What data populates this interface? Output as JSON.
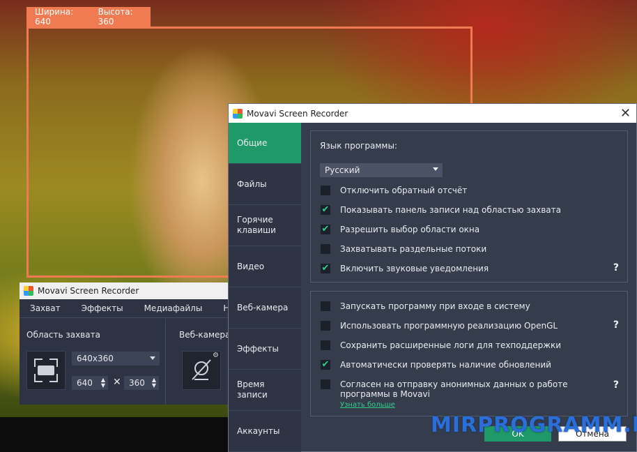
{
  "capture_overlay": {
    "width_label": "Ширина: 640",
    "height_label": "Высота: 360"
  },
  "small_window": {
    "title": "Movavi Screen Recorder",
    "menu": [
      "Захват",
      "Эффекты",
      "Медиафайлы",
      "Настр"
    ],
    "capture_area_label": "Область захвата",
    "resolution_value": "640x360",
    "width_value": "640",
    "height_value": "360",
    "times_sign": "✕",
    "webcam_label": "Веб-камера"
  },
  "dialog": {
    "title": "Movavi Screen Recorder",
    "close_glyph": "✕",
    "nav": [
      {
        "label": "Общие"
      },
      {
        "label": "Файлы"
      },
      {
        "label": "Горячие клавиши"
      },
      {
        "label": "Видео"
      },
      {
        "label": "Веб-камера"
      },
      {
        "label": "Эффекты"
      },
      {
        "label": "Время записи"
      },
      {
        "label": "Аккаунты"
      }
    ],
    "language_label": "Язык программы:",
    "language_value": "Русский",
    "group1": [
      {
        "label": "Отключить обратный отсчёт",
        "checked": false
      },
      {
        "label": "Показывать панель записи над областью захвата",
        "checked": true
      },
      {
        "label": "Разрешить выбор области окна",
        "checked": true
      },
      {
        "label": "Захватывать раздельные потоки",
        "checked": false
      },
      {
        "label": "Включить звуковые уведомления",
        "checked": true
      }
    ],
    "group2": [
      {
        "label": "Запускать программу при входе в систему",
        "checked": false
      },
      {
        "label": "Использовать программную реализацию OpenGL",
        "checked": false
      },
      {
        "label": "Сохранить расширенные логи для техподдержки",
        "checked": false
      },
      {
        "label": "Автоматически проверять наличие обновлений",
        "checked": true
      },
      {
        "label": "Согласен на отправку анонимных данных о работе программы в Movavi",
        "checked": false
      }
    ],
    "learn_more": "Узнать больше",
    "help_glyph": "?",
    "ok_label": "OK",
    "cancel_label": "Отмена"
  },
  "watermark": "MIRPROGRAMM.RU",
  "colors": {
    "accent": "#1f9968",
    "capture_frame": "#f07a52",
    "check": "#2fd18c"
  }
}
